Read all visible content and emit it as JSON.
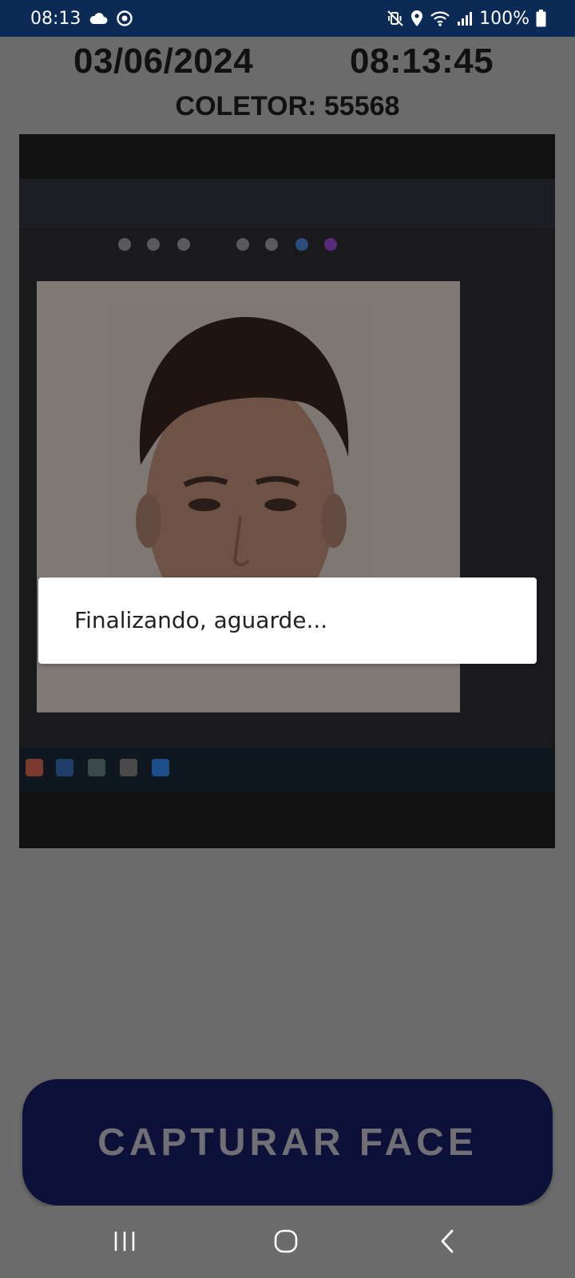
{
  "status_bar": {
    "time": "08:13",
    "battery": "100%",
    "left_icons": [
      "cloud-icon",
      "sync-icon"
    ],
    "right_icons": [
      "vibrate-mute-icon",
      "location-icon",
      "wifi-icon",
      "signal-icon",
      "battery-icon"
    ]
  },
  "header": {
    "date": "03/06/2024",
    "time": "08:13:45",
    "collector": "COLETOR: 55568"
  },
  "dialog": {
    "message": "Finalizando, aguarde..."
  },
  "capture_button": {
    "label": "CAPTURAR FACE"
  },
  "nav_bar": {
    "buttons": [
      "recent-apps-icon",
      "home-icon",
      "back-icon"
    ]
  },
  "colors": {
    "status_bar": "#0b2a55",
    "background_overlay": "#6b6b6b",
    "button": "#0d1038",
    "button_text": "#6f6f75"
  }
}
